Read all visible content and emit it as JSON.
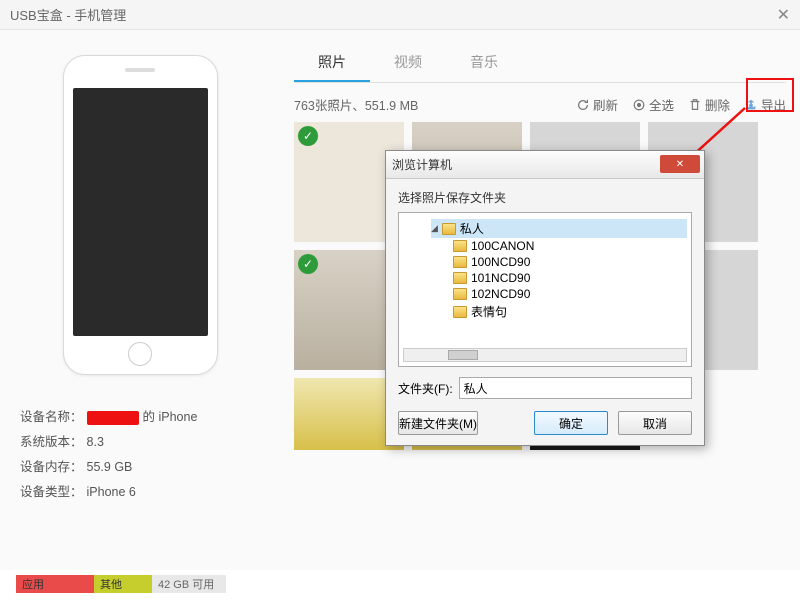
{
  "window": {
    "title": "USB宝盒 - 手机管理"
  },
  "device": {
    "name_label": "设备名称：",
    "name_suffix": "的 iPhone",
    "os_label": "系统版本：",
    "os_value": "8.3",
    "storage_label": "设备内存：",
    "storage_value": "55.9 GB",
    "type_label": "设备类型：",
    "type_value": "iPhone 6"
  },
  "storage_bar": {
    "app": "应用",
    "other": "其他",
    "free": "42 GB 可用"
  },
  "tabs": {
    "photos": "照片",
    "videos": "视频",
    "music": "音乐"
  },
  "toolbar": {
    "status": "763张照片、551.9 MB",
    "refresh": "刷新",
    "select_all": "全选",
    "delete": "删除",
    "export": "导出"
  },
  "dialog": {
    "title": "浏览计算机",
    "label": "选择照片保存文件夹",
    "tree": {
      "root": "私人",
      "children": [
        "100CANON",
        "100NCD90",
        "101NCD90",
        "102NCD90",
        "表情句"
      ]
    },
    "folder_label": "文件夹(F):",
    "folder_value": "私人",
    "new_folder": "新建文件夹(M)",
    "ok": "确定",
    "cancel": "取消"
  }
}
